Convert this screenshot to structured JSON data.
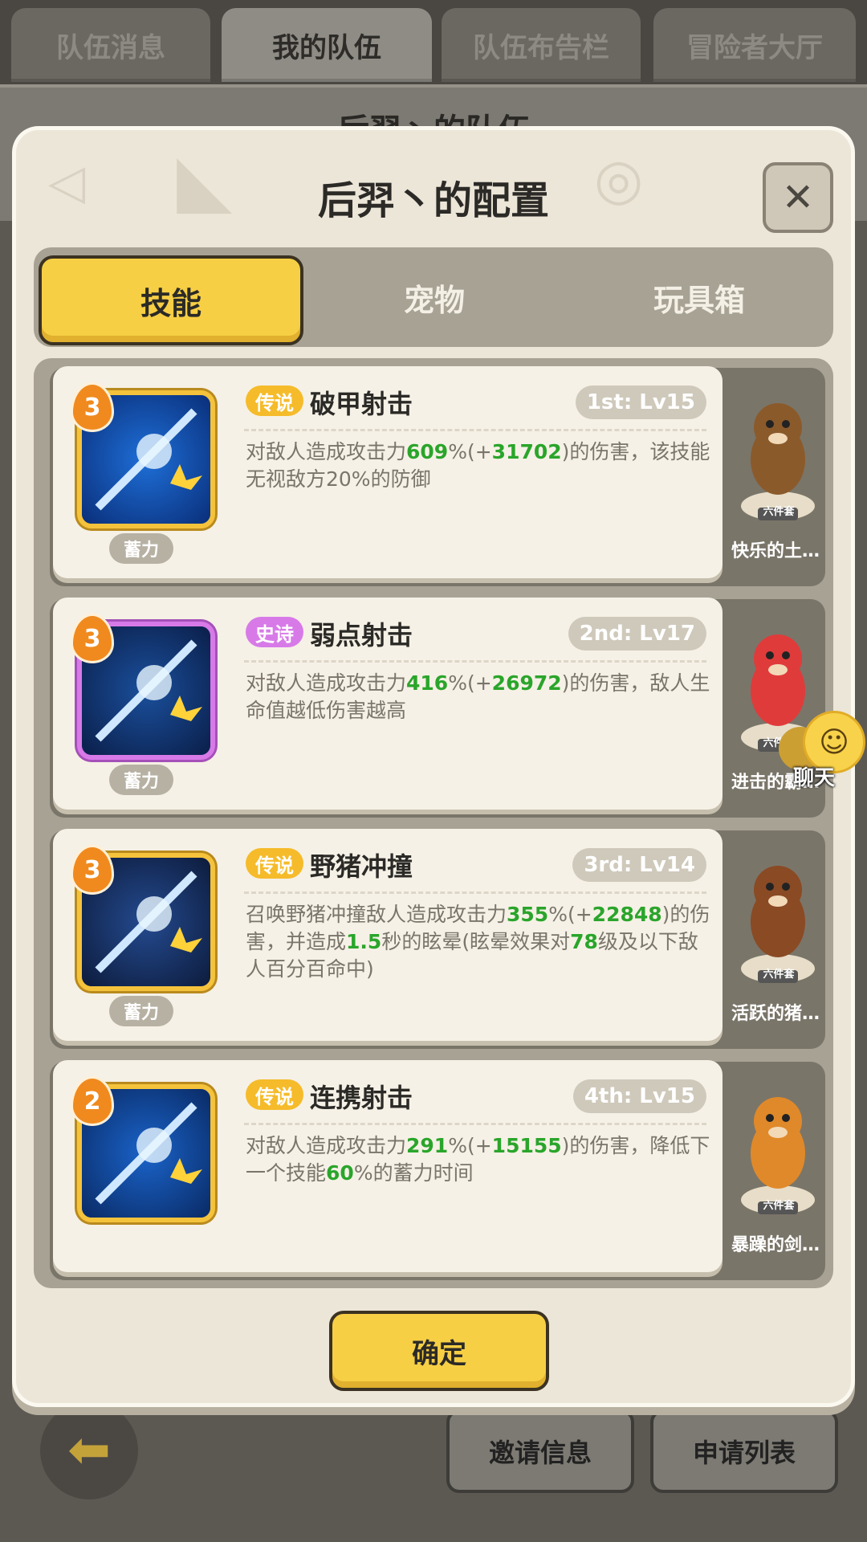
{
  "top_tabs": [
    "队伍消息",
    "我的队伍",
    "队伍布告栏",
    "冒险者大厅"
  ],
  "background_title": "后羿丶的队伍",
  "background_buttons": {
    "invite": "邀请信息",
    "apply": "申请列表"
  },
  "modal": {
    "title": "后羿丶的配置",
    "close_icon": "✕",
    "tabs": [
      "技能",
      "宠物",
      "玩具箱"
    ],
    "skills": [
      {
        "level": "3",
        "rarity": "传说",
        "rarity_type": "legend",
        "name": "破甲射击",
        "slot": "1st: Lv15",
        "charge": "蓄力",
        "desc": [
          {
            "t": "对敌人造成攻击力"
          },
          {
            "t": "609",
            "g": true
          },
          {
            "t": "%(+"
          },
          {
            "t": "31702",
            "g": true
          },
          {
            "t": ")的伤害，该技能无视敌方20%的防御"
          }
        ],
        "pet": {
          "name": "快乐的土…",
          "tag": "六件套",
          "color": "#8b5a2b"
        }
      },
      {
        "level": "3",
        "rarity": "史诗",
        "rarity_type": "epic",
        "name": "弱点射击",
        "slot": "2nd: Lv17",
        "charge": "蓄力",
        "desc": [
          {
            "t": "对敌人造成攻击力"
          },
          {
            "t": "416",
            "g": true
          },
          {
            "t": "%(+"
          },
          {
            "t": "26972",
            "g": true
          },
          {
            "t": ")的伤害，敌人生命值越低伤害越高"
          }
        ],
        "pet": {
          "name": "进击的霸…",
          "tag": "六件套",
          "color": "#e03b3b"
        }
      },
      {
        "level": "3",
        "rarity": "传说",
        "rarity_type": "legend",
        "name": "野猪冲撞",
        "slot": "3rd: Lv14",
        "charge": "蓄力",
        "desc": [
          {
            "t": "召唤野猪冲撞敌人造成攻击力"
          },
          {
            "t": "355",
            "g": true
          },
          {
            "t": "%(+"
          },
          {
            "t": "22848",
            "g": true
          },
          {
            "t": ")的伤害，并造成"
          },
          {
            "t": "1.5",
            "g": true
          },
          {
            "t": "秒的眩晕(眩晕效果对"
          },
          {
            "t": "78",
            "g": true
          },
          {
            "t": "级及以下敌人百分百命中)"
          }
        ],
        "pet": {
          "name": "活跃的猪…",
          "tag": "六件套",
          "color": "#8a4a24"
        }
      },
      {
        "level": "2",
        "rarity": "传说",
        "rarity_type": "legend",
        "name": "连携射击",
        "slot": "4th: Lv15",
        "charge": "",
        "desc": [
          {
            "t": "对敌人造成攻击力"
          },
          {
            "t": "291",
            "g": true
          },
          {
            "t": "%(+"
          },
          {
            "t": "15155",
            "g": true
          },
          {
            "t": ")的伤害，降低下一个技能"
          },
          {
            "t": "60",
            "g": true
          },
          {
            "t": "%的蓄力时间"
          }
        ],
        "pet": {
          "name": "暴躁的剑…",
          "tag": "六件套",
          "color": "#e0892a"
        }
      }
    ],
    "confirm": "确定"
  },
  "chat": {
    "label": "聊天"
  },
  "colors": {
    "accent_yellow": "#f7cf45",
    "green_value": "#2aa52b",
    "epic_purple": "#d77ae8",
    "legend_gold": "#f5bb2a"
  }
}
